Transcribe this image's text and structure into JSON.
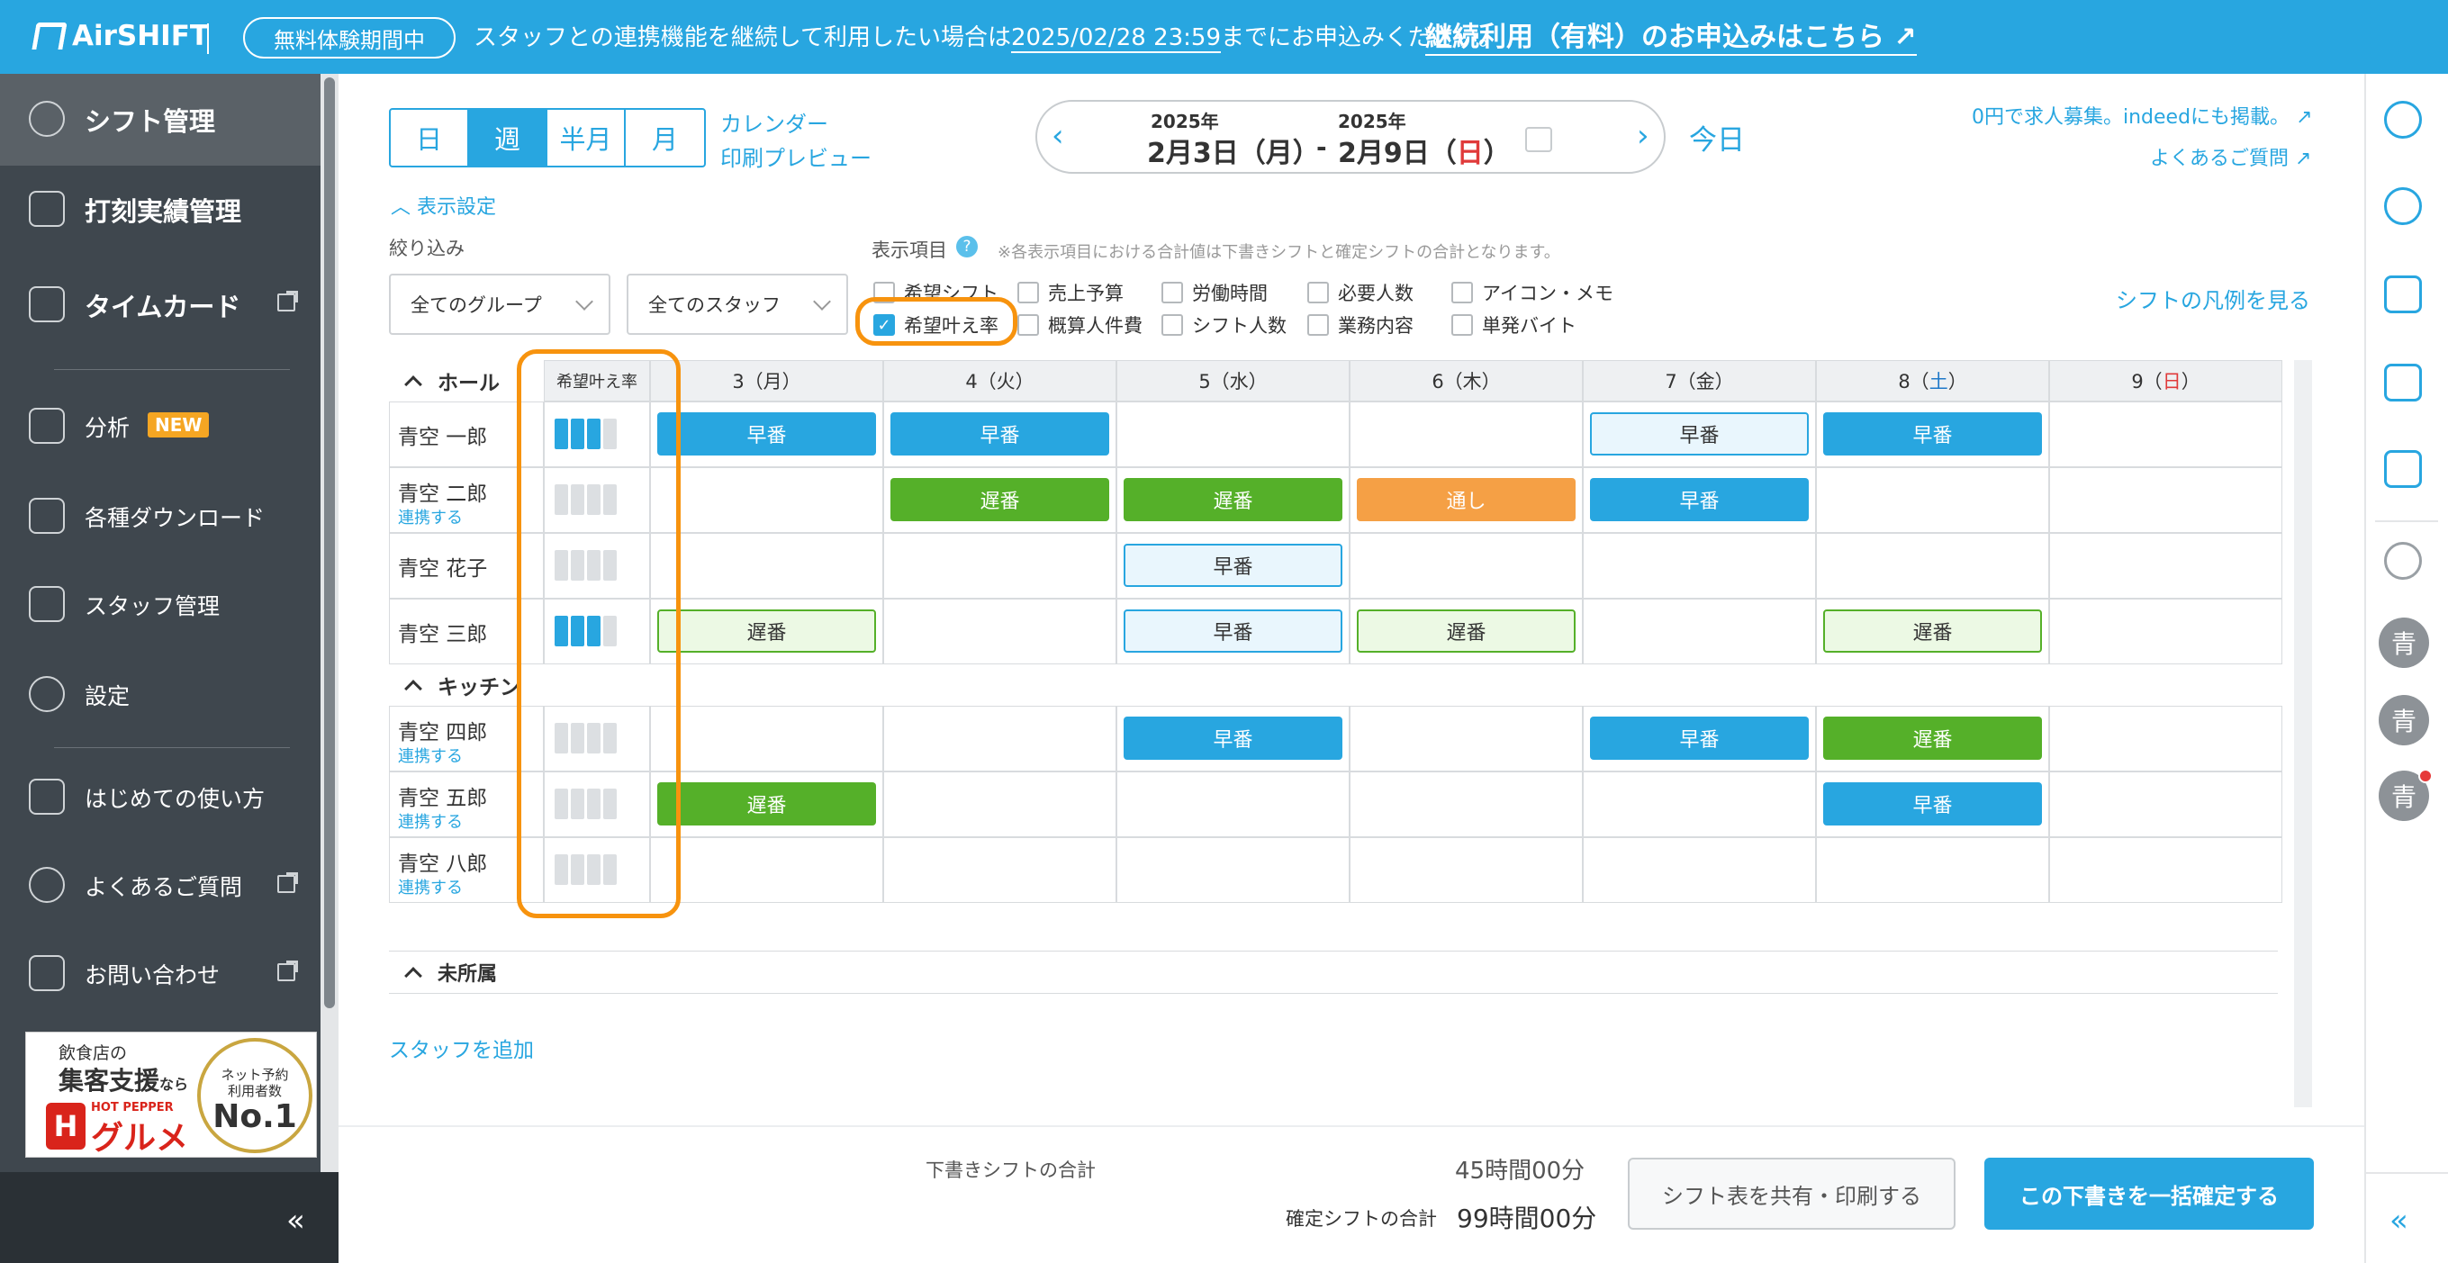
{
  "topbar": {
    "logo": "AirSHIFT",
    "trial_badge": "無料体験期間中",
    "message_prefix": "スタッフとの連携機能を継続して利用したい場合は",
    "message_date": "2025/02/28 23:59",
    "message_suffix": "までにお申込みください。",
    "cta_link": "継続利用（有料）のお申込みはこちら"
  },
  "sidebar": {
    "items": [
      {
        "label": "シフト管理",
        "icon": "shift-icon"
      },
      {
        "label": "打刻実績管理",
        "icon": "clock-record-icon"
      },
      {
        "label": "タイムカード",
        "icon": "timecard-icon"
      },
      {
        "label": "分析",
        "icon": "chart-icon",
        "badge": "NEW"
      },
      {
        "label": "各種ダウンロード",
        "icon": "download-icon"
      },
      {
        "label": "スタッフ管理",
        "icon": "staff-icon"
      },
      {
        "label": "設定",
        "icon": "gear-icon"
      },
      {
        "label": "はじめての使い方",
        "icon": "guide-icon"
      },
      {
        "label": "よくあるご質問",
        "icon": "question-icon"
      },
      {
        "label": "お問い合わせ",
        "icon": "mail-icon"
      }
    ],
    "ad": {
      "line1": "飲食店の",
      "line2": "集客支援",
      "line2_suffix": "なら",
      "brand_small": "HOT PEPPER",
      "brand": "グルメ",
      "circle_line1": "ネット予約",
      "circle_line2": "利用者数",
      "circle_rank": "No.1"
    },
    "collapse": "«"
  },
  "toolbar": {
    "views": [
      "日",
      "週",
      "半月",
      "月"
    ],
    "active_view": "週",
    "calendar_link": "カレンダー",
    "print_preview_link": "印刷プレビュー",
    "start_year": "2025年",
    "end_year": "2025年",
    "start_date": "2月3日（月）",
    "end_date_prefix": "2月9日（",
    "end_date_day": "日",
    "end_date_suffix": "）",
    "separator": "-",
    "today": "今日",
    "recruit_link": "0円で求人募集。indeedにも掲載。",
    "faq_link": "よくあるご質問"
  },
  "display_settings": {
    "toggle_label": "表示設定",
    "filter_label": "絞り込み",
    "group_select": "全てのグループ",
    "staff_select": "全てのスタッフ",
    "items_label": "表示項目",
    "note": "※各表示項目における合計値は下書きシフトと確定シフトの合計となります。",
    "checkboxes": [
      {
        "label": "希望シフト",
        "checked": false
      },
      {
        "label": "売上予算",
        "checked": false
      },
      {
        "label": "労働時間",
        "checked": false
      },
      {
        "label": "必要人数",
        "checked": false
      },
      {
        "label": "アイコン・メモ",
        "checked": false
      },
      {
        "label": "希望叶え率",
        "checked": true
      },
      {
        "label": "概算人件費",
        "checked": false
      },
      {
        "label": "シフト人数",
        "checked": false
      },
      {
        "label": "業務内容",
        "checked": false
      },
      {
        "label": "単発バイト",
        "checked": false
      }
    ],
    "legend_link": "シフトの凡例を見る"
  },
  "grid": {
    "rate_header": "希望叶え率",
    "days": [
      {
        "label": "3（月）",
        "color": "#333333"
      },
      {
        "label": "4（火）",
        "color": "#333333"
      },
      {
        "label": "5（水）",
        "color": "#333333"
      },
      {
        "label": "6（木）",
        "color": "#333333"
      },
      {
        "label": "7（金）",
        "color": "#333333"
      },
      {
        "label": "8（",
        "color": "#333333",
        "accent": "土",
        "accent_color": "#1f79c9",
        "suffix": "）"
      },
      {
        "label": "9（",
        "color": "#333333",
        "accent": "日",
        "accent_color": "#e03a3a",
        "suffix": "）"
      }
    ],
    "groups": [
      {
        "name": "ホール",
        "staff": [
          {
            "name": "青空 一郎",
            "link": "",
            "rate": 3,
            "shifts": [
              [
                "早番",
                "blue"
              ],
              [
                "早番",
                "blue"
              ],
              null,
              null,
              [
                "早番",
                "lblue"
              ],
              [
                "早番",
                "blue"
              ],
              null
            ]
          },
          {
            "name": "青空 二郎",
            "link": "連携する",
            "rate": 0,
            "shifts": [
              null,
              [
                "遅番",
                "green"
              ],
              [
                "遅番",
                "green"
              ],
              [
                "通し",
                "orange"
              ],
              [
                "早番",
                "blue"
              ],
              null,
              null
            ]
          },
          {
            "name": "青空 花子",
            "link": "",
            "rate": 0,
            "shifts": [
              null,
              null,
              [
                "早番",
                "lblue"
              ],
              null,
              null,
              null,
              null
            ]
          },
          {
            "name": "青空 三郎",
            "link": "",
            "rate": 3,
            "shifts": [
              [
                "遅番",
                "lgreen"
              ],
              null,
              [
                "早番",
                "lblue"
              ],
              [
                "遅番",
                "lgreen"
              ],
              null,
              [
                "遅番",
                "lgreen"
              ],
              null
            ]
          }
        ]
      },
      {
        "name": "キッチン",
        "staff": [
          {
            "name": "青空 四郎",
            "link": "連携する",
            "rate": 0,
            "shifts": [
              null,
              null,
              [
                "早番",
                "blue"
              ],
              null,
              [
                "早番",
                "blue"
              ],
              [
                "遅番",
                "green"
              ],
              null
            ]
          },
          {
            "name": "青空 五郎",
            "link": "連携する",
            "rate": 0,
            "shifts": [
              [
                "遅番",
                "green"
              ],
              null,
              null,
              null,
              null,
              [
                "早番",
                "blue"
              ],
              null
            ]
          },
          {
            "name": "青空 八郎",
            "link": "連携する",
            "rate": 0,
            "shifts": [
              null,
              null,
              null,
              null,
              null,
              null,
              null
            ]
          }
        ]
      }
    ],
    "unassigned": "未所属",
    "add_staff": "スタッフを追加"
  },
  "footer": {
    "draft_label": "下書きシフトの合計",
    "draft_value": "45時間00分",
    "confirmed_label": "確定シフトの合計",
    "confirmed_value": "99時間00分",
    "share_button": "シフト表を共有・印刷する",
    "confirm_button": "この下書きを一括確定する"
  },
  "rail": {
    "icons": [
      "info-icon",
      "add-user-icon",
      "shift-check-icon",
      "hourglass-doc-icon",
      "approve-doc-icon",
      "chat-icon"
    ],
    "avatars": [
      "青",
      "青",
      "青"
    ],
    "collapse": "«"
  },
  "colors": {
    "accent": "#28a6e0",
    "highlight": "#f7930e",
    "shift_blue": "#28a6e0",
    "shift_green": "#55b029",
    "shift_orange": "#f5a045"
  }
}
